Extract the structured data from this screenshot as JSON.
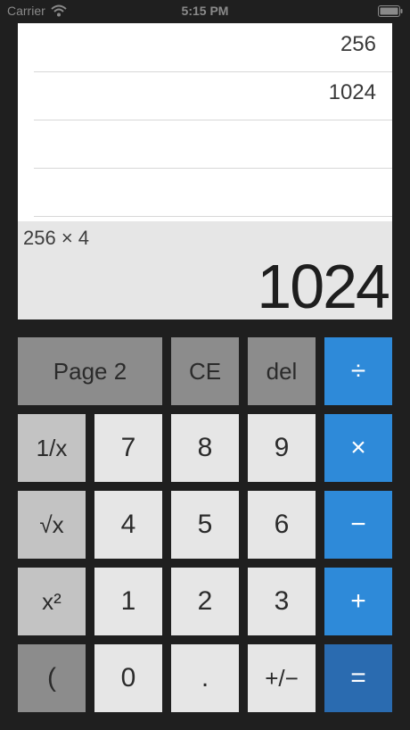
{
  "status_bar": {
    "carrier": "Carrier",
    "time": "5:15 PM"
  },
  "history": {
    "entries": [
      "256",
      "1024",
      "",
      ""
    ]
  },
  "display": {
    "expression": "256 × 4",
    "result": "1024"
  },
  "keypad": {
    "page2": "Page 2",
    "ce": "CE",
    "del": "del",
    "divide": "÷",
    "reciprocal": "1/x",
    "seven": "7",
    "eight": "8",
    "nine": "9",
    "multiply": "×",
    "sqrt": "√x",
    "four": "4",
    "five": "5",
    "six": "6",
    "minus": "−",
    "square": "x²",
    "one": "1",
    "two": "2",
    "three": "3",
    "plus": "+",
    "paren": "(",
    "zero": "0",
    "dot": ".",
    "sign": "+/−",
    "equals": "="
  },
  "colors": {
    "background": "#1f1f1f",
    "operator_blue": "#2e8ad9",
    "equals_blue": "#2a6bb0",
    "function_gray": "#8c8c8c"
  }
}
